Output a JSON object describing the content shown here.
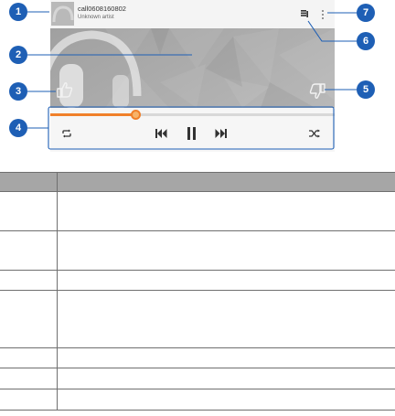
{
  "player": {
    "song_title": "call0608160802",
    "song_artist": "Unknown artist",
    "progress": 0.3
  },
  "callouts": [
    "1",
    "2",
    "3",
    "4",
    "5",
    "6",
    "7"
  ],
  "table": {
    "header": [
      "",
      ""
    ],
    "rows": [
      [
        "",
        ""
      ],
      [
        "",
        ""
      ],
      [
        "",
        ""
      ],
      [
        "",
        ""
      ],
      [
        "",
        ""
      ],
      [
        "",
        ""
      ],
      [
        "",
        ""
      ]
    ]
  },
  "colors": {
    "callout": "#1e5fb5",
    "progress": "#f0802a",
    "table_header": "#a6a6a6"
  }
}
